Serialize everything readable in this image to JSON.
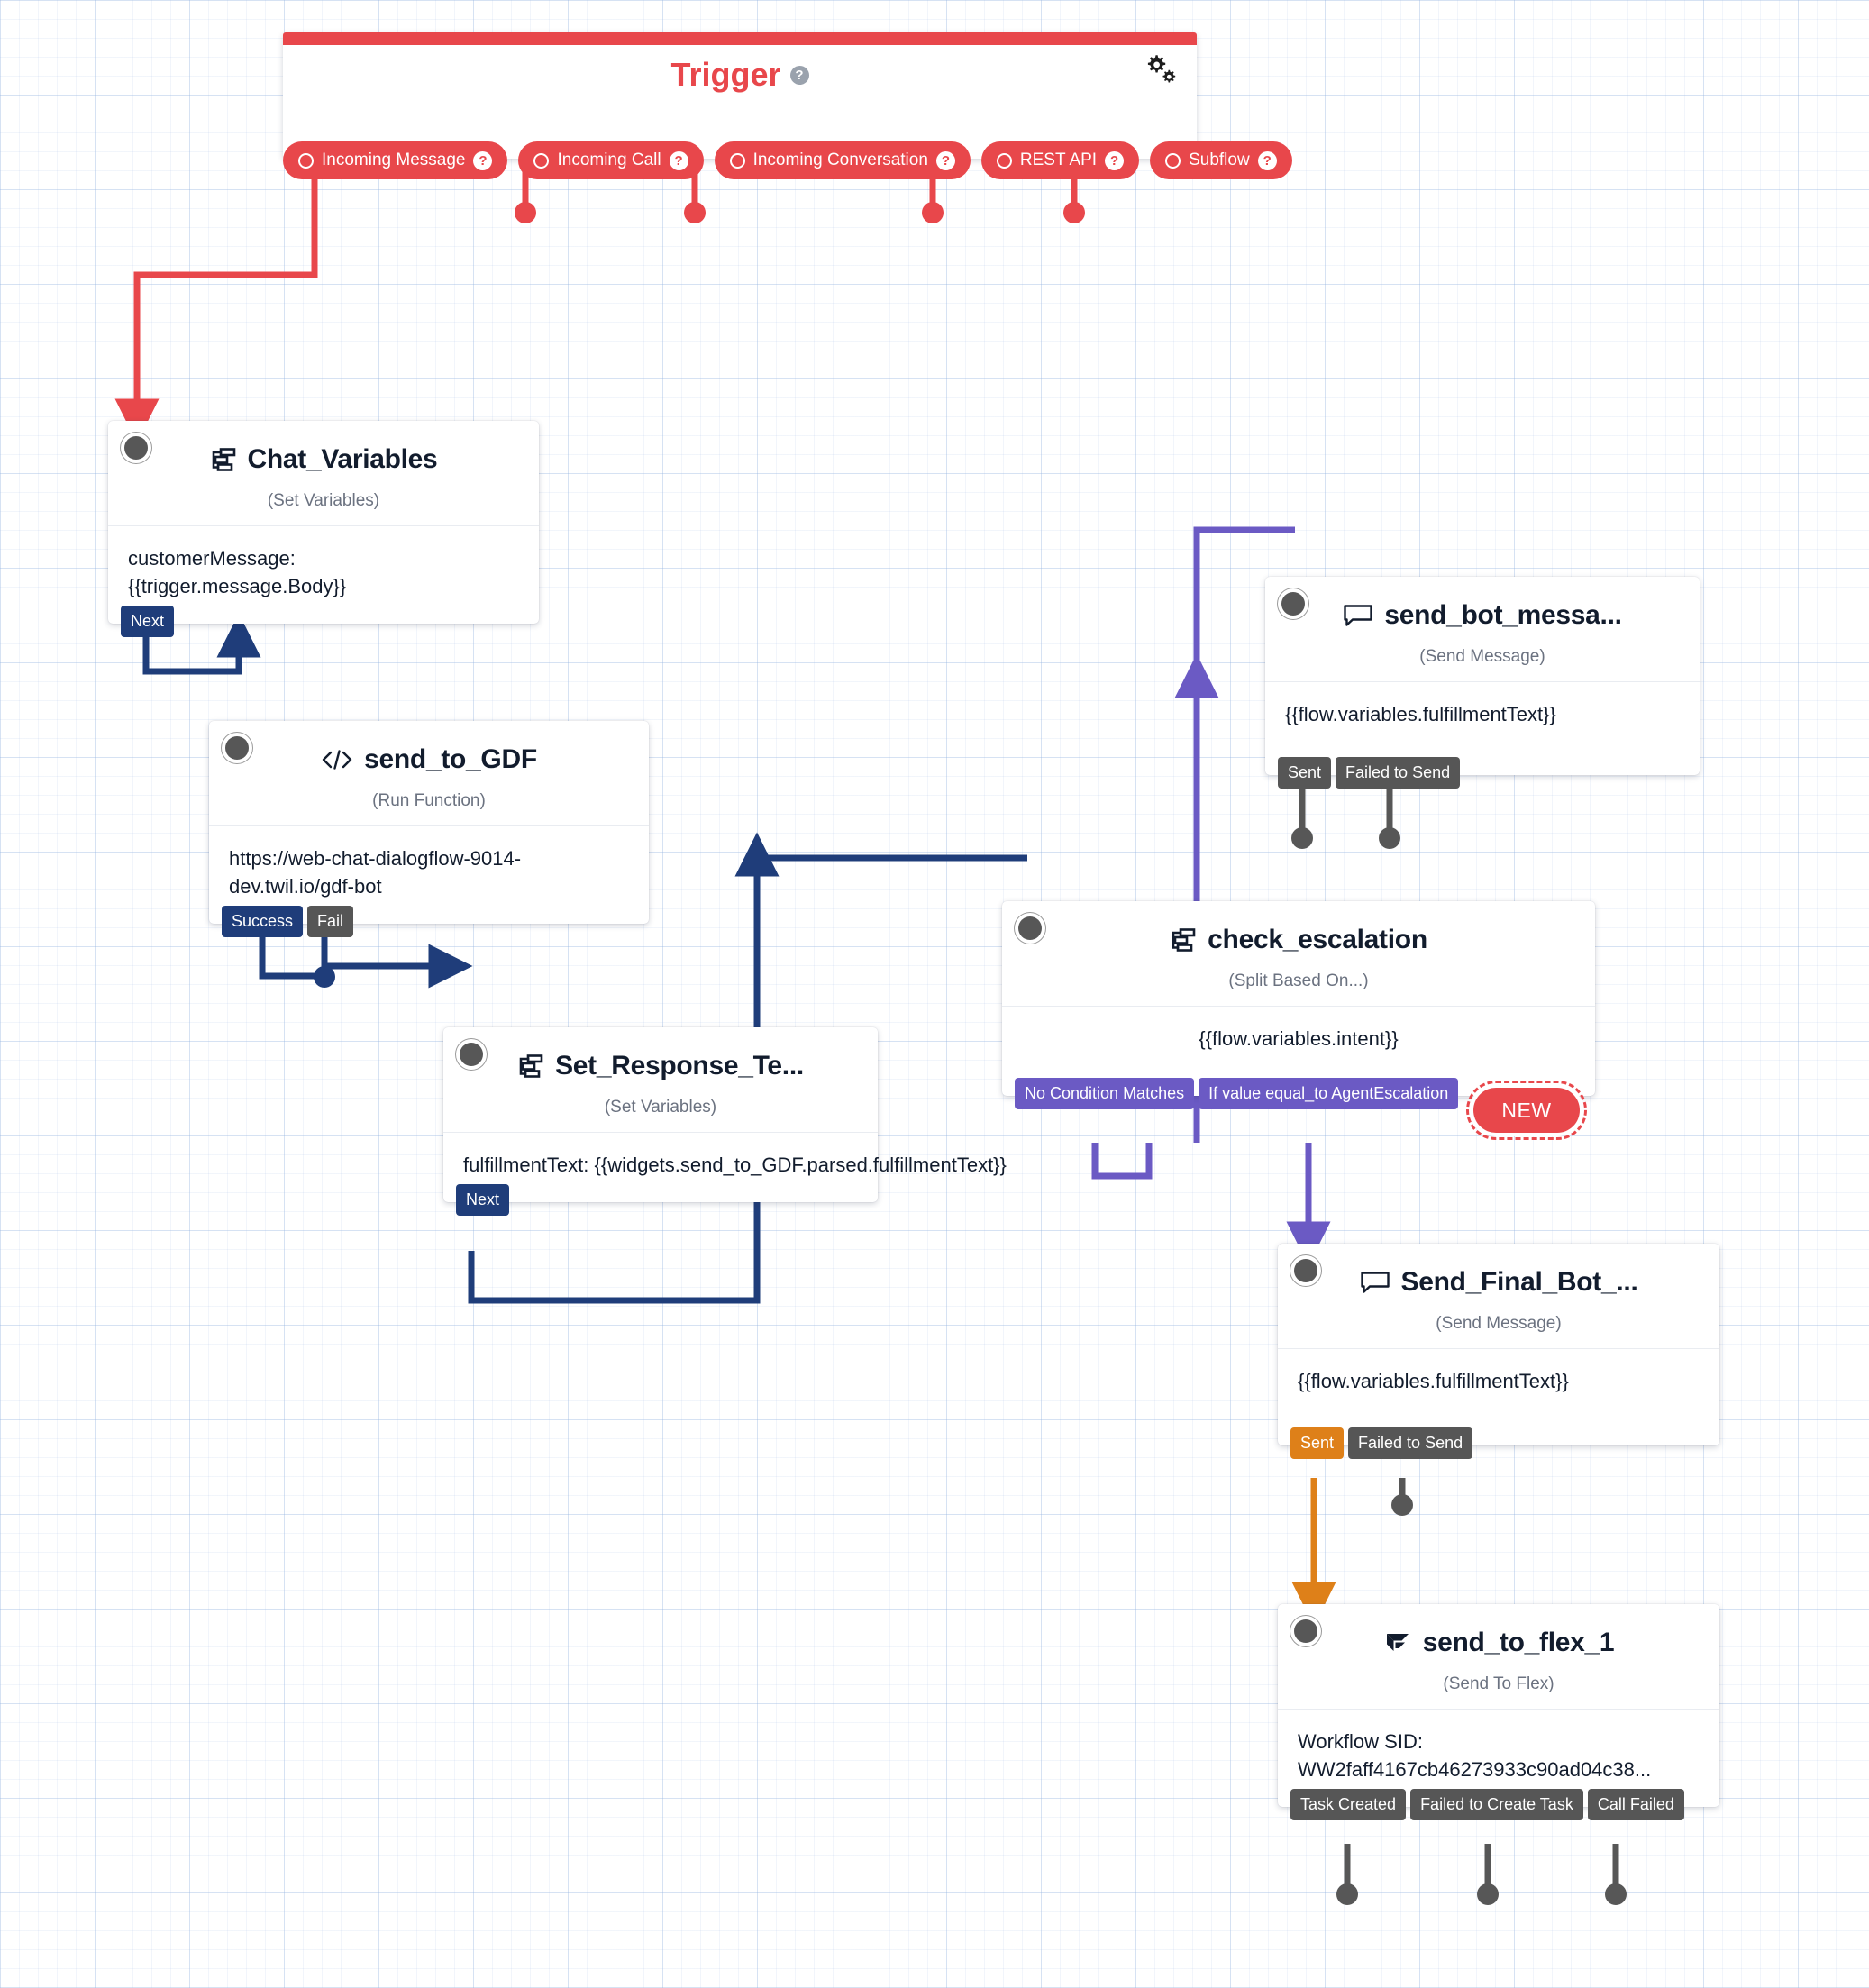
{
  "canvas": {
    "type": "studio-flow-canvas"
  },
  "trigger": {
    "title": "Trigger",
    "help_icon": "help-icon",
    "settings_icon": "gears-icon",
    "transitions": [
      {
        "label": "Incoming Message",
        "help": "?"
      },
      {
        "label": "Incoming Call",
        "help": "?"
      },
      {
        "label": "Incoming Conversation",
        "help": "?"
      },
      {
        "label": "REST API",
        "help": "?"
      },
      {
        "label": "Subflow",
        "help": "?"
      }
    ]
  },
  "widgets": {
    "chat_variables": {
      "title": "Chat_Variables",
      "type": "(Set Variables)",
      "icon": "set-variables-icon",
      "body": "customerMessage:\n{{trigger.message.Body}}",
      "transitions": [
        {
          "label": "Next",
          "color": "blue"
        }
      ]
    },
    "send_to_gdf": {
      "title": "send_to_GDF",
      "type": "(Run Function)",
      "icon": "code-icon",
      "body": "https://web-chat-dialogflow-9014-dev.twil.io/gdf-bot",
      "transitions": [
        {
          "label": "Success",
          "color": "blue"
        },
        {
          "label": "Fail",
          "color": "gray"
        }
      ]
    },
    "set_response_text": {
      "title": "Set_Response_Te...",
      "type": "(Set Variables)",
      "icon": "set-variables-icon",
      "body": "fulfillmentText:\n{{widgets.send_to_GDF.parsed.fulfillmentText}}",
      "transitions": [
        {
          "label": "Next",
          "color": "blue"
        }
      ]
    },
    "check_escalation": {
      "title": "check_escalation",
      "type": "(Split Based On...)",
      "icon": "split-icon",
      "body": "{{flow.variables.intent}}",
      "transitions": [
        {
          "label": "No Condition Matches",
          "color": "purple"
        },
        {
          "label": "If value equal_to AgentEscalation",
          "color": "purple"
        }
      ],
      "new_badge": "NEW"
    },
    "send_bot_message": {
      "title": "send_bot_messa...",
      "type": "(Send Message)",
      "icon": "message-icon",
      "body": "{{flow.variables.fulfillmentText}}",
      "transitions": [
        {
          "label": "Sent",
          "color": "gray"
        },
        {
          "label": "Failed to Send",
          "color": "gray"
        }
      ]
    },
    "send_final_bot": {
      "title": "Send_Final_Bot_...",
      "type": "(Send Message)",
      "icon": "message-icon",
      "body": "{{flow.variables.fulfillmentText}}",
      "transitions": [
        {
          "label": "Sent",
          "color": "orange"
        },
        {
          "label": "Failed to Send",
          "color": "gray"
        }
      ]
    },
    "send_to_flex": {
      "title": "send_to_flex_1",
      "type": "(Send To Flex)",
      "icon": "flex-icon",
      "body": "Workflow SID:\nWW2faff4167cb46273933c90ad04c38...",
      "transitions": [
        {
          "label": "Task Created",
          "color": "gray"
        },
        {
          "label": "Failed to Create Task",
          "color": "gray"
        },
        {
          "label": "Call Failed",
          "color": "gray"
        }
      ]
    }
  },
  "colors": {
    "trigger_red": "#e8474b",
    "navy": "#1f3d7a",
    "purple": "#6b5ac4",
    "orange": "#de8019",
    "gray": "#565656"
  }
}
